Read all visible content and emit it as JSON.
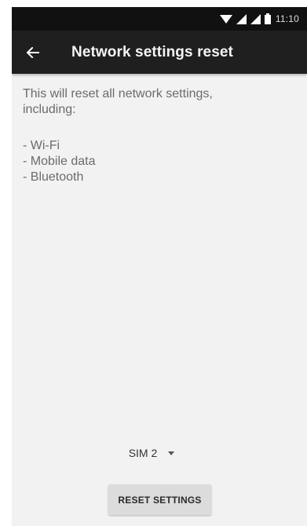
{
  "status_bar": {
    "time": "11:10",
    "icons": [
      "wifi-icon",
      "signal-icon",
      "signal-icon",
      "battery-icon"
    ]
  },
  "app_bar": {
    "back_icon": "arrow-back-icon",
    "title": "Network settings reset"
  },
  "content": {
    "description": "This will reset all network settings, including:",
    "items": [
      "- Wi-Fi",
      "- Mobile data",
      "- Bluetooth"
    ]
  },
  "sim_selector": {
    "selected": "SIM 2",
    "icon": "dropdown-arrow-icon"
  },
  "reset_button": {
    "label": "RESET SETTINGS"
  },
  "colors": {
    "status_bar_bg": "#111111",
    "app_bar_bg": "#1f1f1f",
    "screen_bg": "#f2f2f2",
    "button_bg": "#dcdcdc"
  }
}
